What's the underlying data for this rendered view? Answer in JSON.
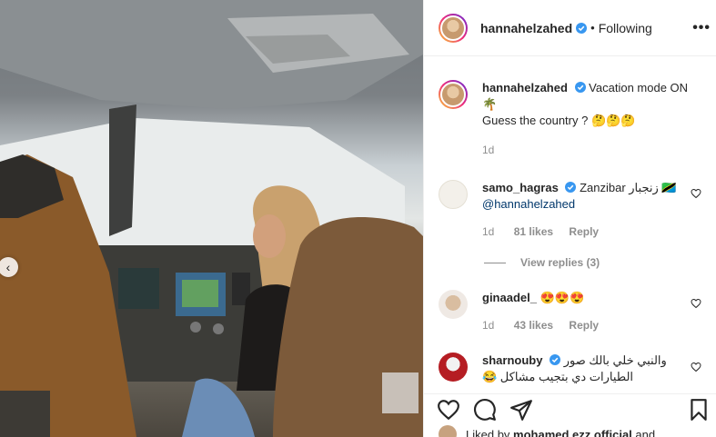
{
  "post": {
    "username": "hannahelzahed",
    "follow_status": "Following",
    "more_icon": "more-options-icon",
    "caption_line1": "Vacation mode ON",
    "caption_line1_emoji": "🌴",
    "caption_line2": "Guess the country ? 🤔🤔🤔",
    "caption_time": "1d"
  },
  "comments": [
    {
      "username": "samo_hagras",
      "text": "Zanzibar زنجبار 🇹🇿",
      "mention": "@hannahelzahed",
      "time": "1d",
      "likes": "81 likes",
      "reply": "Reply",
      "view_replies": "View replies (3)"
    },
    {
      "username": "ginaadel_",
      "text": "😍😍😍",
      "time": "1d",
      "likes": "43 likes",
      "reply": "Reply"
    },
    {
      "username": "sharnouby",
      "text": "والنبي خلي بالك صور",
      "text2": "الطيارات دي بتجيب مشاكل 😂"
    }
  ],
  "footer": {
    "liked_by_prefix": "Liked by",
    "liked_by_user": "mohamed.ezz.official",
    "liked_by_suffix": "and"
  },
  "colors": {
    "verified": "#3897f0",
    "text": "#262626",
    "muted": "#8e8e8e"
  }
}
